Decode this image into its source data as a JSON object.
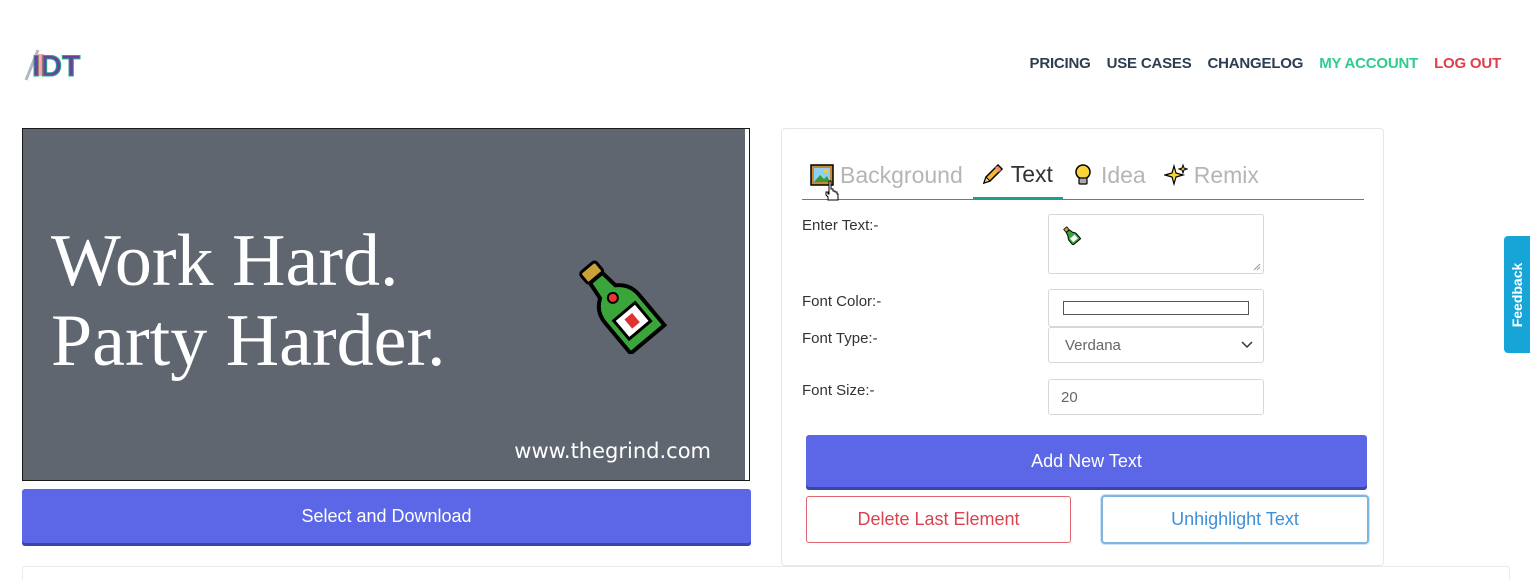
{
  "logo": {
    "icon": "idt-logo-icon",
    "text": "IDT"
  },
  "nav": {
    "pricing": "PRICING",
    "use_cases": "USE CASES",
    "changelog": "CHANGELOG",
    "my_account": "MY ACCOUNT",
    "log_out": "LOG OUT"
  },
  "canvas": {
    "line1": "Work Hard.",
    "line2": "Party Harder.",
    "emoji": "champagne-bottle-icon",
    "url": "www.thegrind.com",
    "background_color": "#5f6670"
  },
  "download_button": "Select and Download",
  "tabs": [
    {
      "label": "Background",
      "icon": "framed-picture-icon"
    },
    {
      "label": "Text",
      "icon": "pencil-icon"
    },
    {
      "label": "Idea",
      "icon": "light-bulb-icon"
    },
    {
      "label": "Remix",
      "icon": "sparkles-icon"
    }
  ],
  "form": {
    "enter_text_label": "Enter Text:-",
    "enter_text_value": "champagne-bottle-icon",
    "font_color_label": "Font Color:-",
    "font_color_value": "#ffffff",
    "font_type_label": "Font Type:-",
    "font_type_value": "Verdana",
    "font_size_label": "Font Size:-",
    "font_size_value": "20"
  },
  "buttons": {
    "add_new_text": "Add New Text",
    "delete_last": "Delete Last Element",
    "unhighlight": "Unhighlight Text"
  },
  "feedback": "Feedback",
  "colors": {
    "primary": "#5b67e6",
    "accent": "#1e9e8c",
    "danger": "#d9434f",
    "info": "#3f8fd6",
    "feedback": "#17a5d8"
  }
}
